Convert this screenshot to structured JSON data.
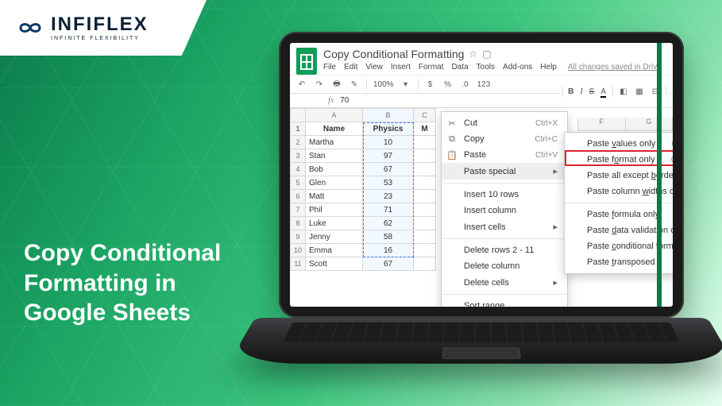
{
  "brand": {
    "name": "INFIFLEX",
    "tagline": "INFINITE  FLEXIBILITY"
  },
  "hero_title": "Copy Conditional Formatting in Google Sheets",
  "doc": {
    "title": "Copy Conditional Formatting",
    "menus": [
      "File",
      "Edit",
      "View",
      "Insert",
      "Format",
      "Data",
      "Tools",
      "Add-ons",
      "Help"
    ],
    "save_status": "All changes saved in Drive"
  },
  "toolbar": {
    "zoom": "100%",
    "currency": "$",
    "percent": "%",
    "decimals": ".0",
    "more_fmt": "123"
  },
  "toolbar2": {
    "bold": "B",
    "italic": "I",
    "strike": "S",
    "color": "A"
  },
  "fx": {
    "label": "fx",
    "value": "70"
  },
  "columns": [
    "",
    "A",
    "B",
    "C"
  ],
  "extra_columns": [
    "F",
    "G"
  ],
  "headers": {
    "name": "Name",
    "physics": "Physics",
    "m": "M"
  },
  "rows": [
    {
      "n": 2,
      "name": "Martha",
      "physics": 10,
      "hl": true
    },
    {
      "n": 3,
      "name": "Stan",
      "physics": 97
    },
    {
      "n": 4,
      "name": "Bob",
      "physics": 67
    },
    {
      "n": 5,
      "name": "Glen",
      "physics": 53
    },
    {
      "n": 6,
      "name": "Matt",
      "physics": 23,
      "hl": true
    },
    {
      "n": 7,
      "name": "Phil",
      "physics": 71
    },
    {
      "n": 8,
      "name": "Luke",
      "physics": 62
    },
    {
      "n": 9,
      "name": "Jenny",
      "physics": 58
    },
    {
      "n": 10,
      "name": "Emma",
      "physics": 16,
      "hl": true
    },
    {
      "n": 11,
      "name": "Scott",
      "physics": 67
    }
  ],
  "context_menu": {
    "items": [
      {
        "icon": "cut",
        "label": "Cut",
        "shortcut": "Ctrl+X"
      },
      {
        "icon": "copy",
        "label": "Copy",
        "shortcut": "Ctrl+C"
      },
      {
        "icon": "paste",
        "label": "Paste",
        "shortcut": "Ctrl+V"
      },
      {
        "label_html": "Paste special",
        "submenu": true,
        "highlight": true
      },
      {
        "divider": true
      },
      {
        "label": "Insert 10 rows"
      },
      {
        "label": "Insert column"
      },
      {
        "label": "Insert cells",
        "submenu": true
      },
      {
        "divider": true
      },
      {
        "label": "Delete rows 2 - 11"
      },
      {
        "label": "Delete column"
      },
      {
        "label": "Delete cells",
        "submenu": true
      },
      {
        "divider": true
      },
      {
        "label": "Sort range"
      }
    ]
  },
  "paste_special_menu": {
    "items": [
      {
        "label_html": "Paste <u>v</u>alues only",
        "shortcut": "Ctrl+Shift+V"
      },
      {
        "label_html": "Paste f<u>o</u>rmat only",
        "shortcut": "Ctrl+Alt+V",
        "boxed": true
      },
      {
        "label_html": "Paste all except <u>b</u>orders"
      },
      {
        "label_html": "Paste column <u>w</u>idths only"
      },
      {
        "divider": true
      },
      {
        "label_html": "Paste <u>f</u>ormula only"
      },
      {
        "label_html": "Paste <u>d</u>ata validation only"
      },
      {
        "label_html": "Paste <u>c</u>onditional formatting only"
      },
      {
        "label_html": "Paste <u>t</u>ransposed"
      }
    ]
  },
  "chart_data": null
}
